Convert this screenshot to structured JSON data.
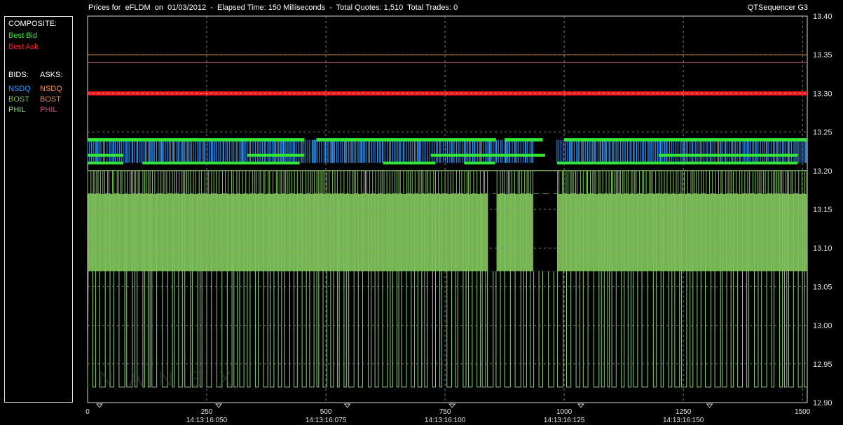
{
  "header": {
    "title": "Prices for  eFLDM  on  01/03/2012  -  Elapsed Time: 150 Milliseconds  -  Total Quotes: 1,510  Total Trades: 0",
    "app": "QTSequencer G3"
  },
  "legend": {
    "composite_label": "COMPOSITE:",
    "best_bid": "Best Bid",
    "best_ask": "Best Ask",
    "bids_label": "BIDS:",
    "asks_label": "ASKS:",
    "bids": [
      "NSDQ",
      "BOST",
      "PHIL"
    ],
    "asks": [
      "NSDQ",
      "BOST",
      "PHIL"
    ]
  },
  "colors": {
    "best_bid": "#33e633",
    "best_ask": "#ff1a1a",
    "nsdq_bid": "#3399ff",
    "bost_bid": "#7fc25a",
    "phil_bid": "#90d080",
    "nsdq_ask": "#ff8a3d",
    "bost_ask": "#d9906a",
    "phil_ask": "#c2507a",
    "grid": "#9a9a9a",
    "frame": "#d9d9d9"
  },
  "watermark": "NANEX",
  "chart_data": {
    "type": "line",
    "xlim": [
      0,
      1510
    ],
    "ylim": [
      12.9,
      13.4
    ],
    "x_ticks": [
      0,
      250,
      500,
      750,
      1000,
      1250,
      1500
    ],
    "x_time_labels": [
      {
        "x": 250,
        "label": "14:13:16:050"
      },
      {
        "x": 500,
        "label": "14:13:16:075"
      },
      {
        "x": 750,
        "label": "14:13:16:100"
      },
      {
        "x": 1000,
        "label": "14:13:16:125"
      },
      {
        "x": 1250,
        "label": "14:13:16:150"
      }
    ],
    "y_ticks": [
      "12.90",
      "12.95",
      "13.00",
      "13.05",
      "13.10",
      "13.15",
      "13.20",
      "13.25",
      "13.30",
      "13.35",
      "13.40"
    ],
    "grid": true,
    "series": [
      {
        "name": "Best Ask",
        "level": 13.3
      },
      {
        "name": "NSDQ",
        "side": "ask",
        "level": 13.35
      },
      {
        "name": "PHIL",
        "side": "ask",
        "level": 13.34
      },
      {
        "name": "Best Bid",
        "high": 13.24,
        "low": 13.21
      },
      {
        "name": "NSDQ",
        "side": "bid",
        "high": 13.24,
        "low": 13.21
      },
      {
        "name": "BOST",
        "side": "bid",
        "high": 13.2,
        "low": 13.07
      },
      {
        "name": "PHIL",
        "side": "bid",
        "high": 13.17,
        "low": 12.92
      }
    ],
    "gaps": [
      [
        840,
        858
      ],
      [
        935,
        985
      ]
    ]
  }
}
